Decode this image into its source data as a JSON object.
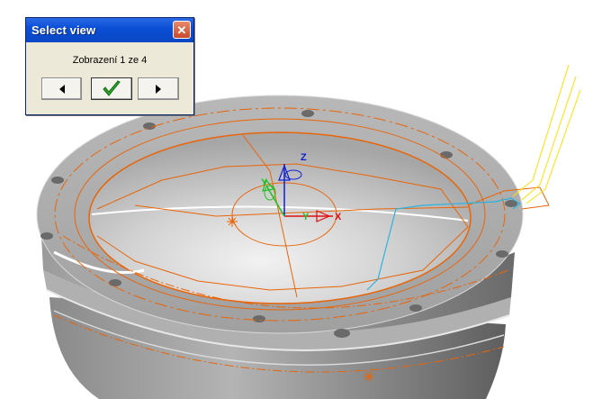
{
  "dialog": {
    "title": "Select view",
    "status_text": "Zobrazení 1  ze 4",
    "buttons": {
      "previous_icon": "left-triangle-icon",
      "confirm_icon": "green-checkmark-icon",
      "next_icon": "right-triangle-icon",
      "close_icon": "close-x-icon"
    }
  },
  "viewport": {
    "axes": {
      "z_label": "Z",
      "x_label": "X",
      "y_label": "Y",
      "y_label_2": "Y"
    },
    "colors": {
      "toolpath": "#e8650a",
      "link_path": "#2bb3e0",
      "approach_path": "#ffe000",
      "x_axis": "#e01010",
      "y_axis": "#20c020",
      "z_axis": "#1020d0",
      "background": "#ffffff"
    }
  }
}
